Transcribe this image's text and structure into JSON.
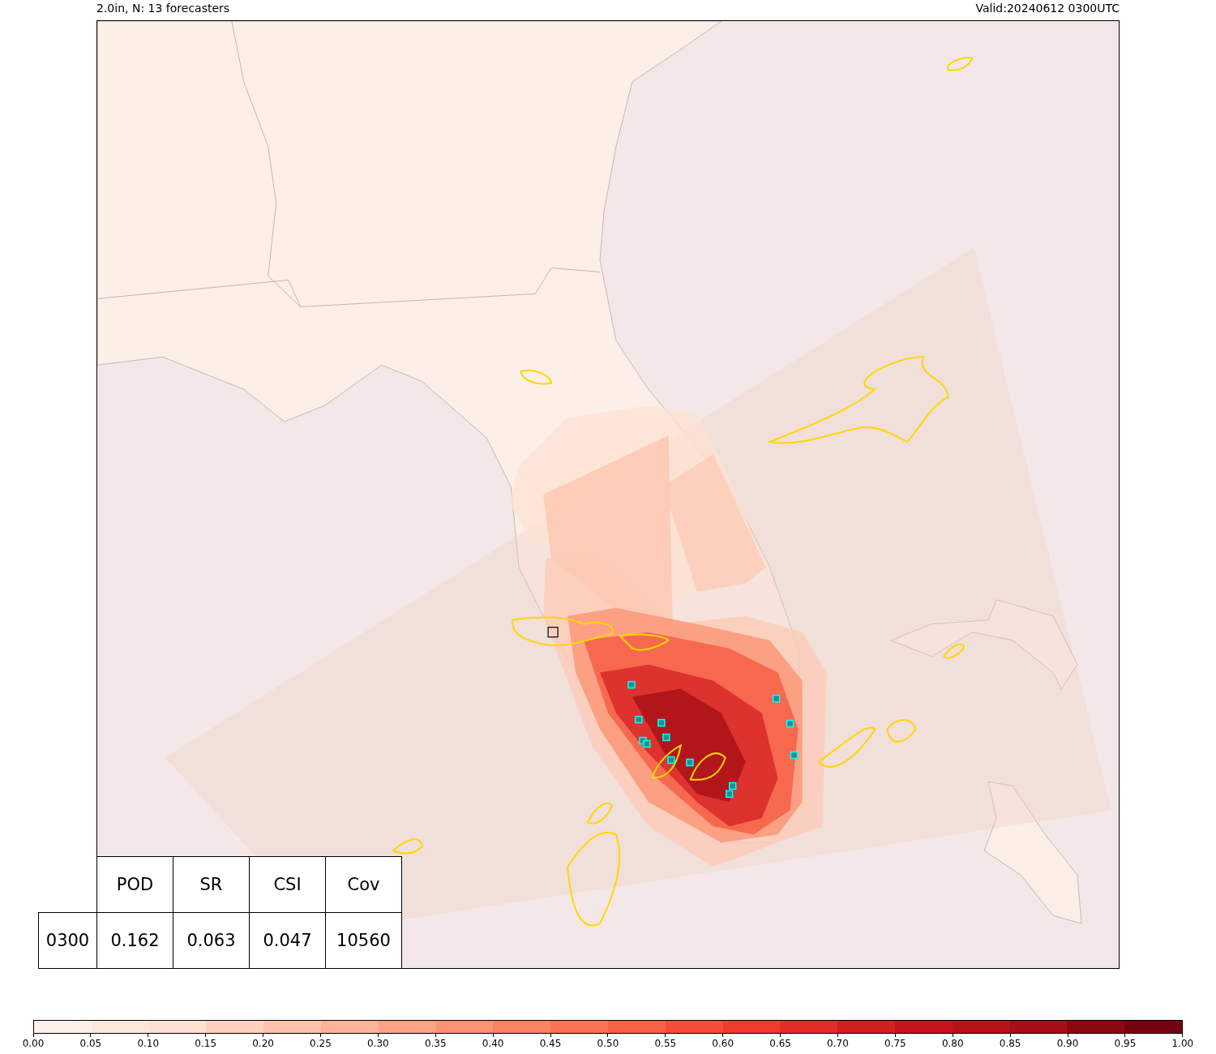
{
  "title_left": "2.0in, N: 13 forecasters",
  "title_right": "Valid:20240612 0300UTC",
  "table": {
    "columns": [
      "POD",
      "SR",
      "CSI",
      "Cov"
    ],
    "rows": [
      {
        "label": "0300",
        "cells": [
          "0.162",
          "0.063",
          "0.047",
          "10560"
        ]
      }
    ]
  },
  "colorbar": {
    "ticks": [
      "0.00",
      "0.05",
      "0.10",
      "0.15",
      "0.20",
      "0.25",
      "0.30",
      "0.35",
      "0.40",
      "0.45",
      "0.50",
      "0.55",
      "0.60",
      "0.65",
      "0.70",
      "0.75",
      "0.80",
      "0.85",
      "0.90",
      "0.95",
      "1.00"
    ]
  }
}
